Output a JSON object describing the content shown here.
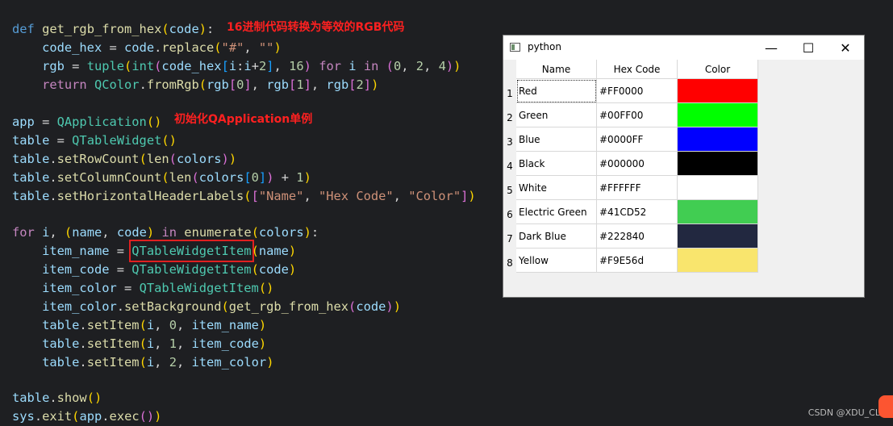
{
  "code_lines": [
    "def get_rgb_from_hex(code):",
    "    code_hex = code.replace(\"#\", \"\")",
    "    rgb = tuple(int(code_hex[i:i+2], 16) for i in (0, 2, 4))",
    "    return QColor.fromRgb(rgb[0], rgb[1], rgb[2])",
    "",
    "app = QApplication()",
    "table = QTableWidget()",
    "table.setRowCount(len(colors))",
    "table.setColumnCount(len(colors[0]) + 1)",
    "table.setHorizontalHeaderLabels([\"Name\", \"Hex Code\", \"Color\"])",
    "",
    "for i, (name, code) in enumerate(colors):",
    "    item_name = QTableWidgetItem(name)",
    "    item_code = QTableWidgetItem(code)",
    "    item_color = QTableWidgetItem()",
    "    item_color.setBackground(get_rgb_from_hex(code))",
    "    table.setItem(i, 0, item_name)",
    "    table.setItem(i, 1, item_code)",
    "    table.setItem(i, 2, item_color)",
    "",
    "table.show()",
    "sys.exit(app.exec())"
  ],
  "annotations": {
    "hex_to_rgb": "16进制代码转换为等效的RGB代码",
    "init_app": "初始化QApplication单例"
  },
  "window": {
    "title": "python",
    "icon": "app-window-icon",
    "controls": {
      "minimize": "—",
      "maximize": "☐",
      "close": "✕"
    }
  },
  "table": {
    "headers": [
      "Name",
      "Hex Code",
      "Color"
    ],
    "rows": [
      {
        "num": "1",
        "name": "Red",
        "hex": "#FF0000",
        "color": "#FF0000"
      },
      {
        "num": "2",
        "name": "Green",
        "hex": "#00FF00",
        "color": "#00FF00"
      },
      {
        "num": "3",
        "name": "Blue",
        "hex": "#0000FF",
        "color": "#0000FF"
      },
      {
        "num": "4",
        "name": "Black",
        "hex": "#000000",
        "color": "#000000"
      },
      {
        "num": "5",
        "name": "White",
        "hex": "#FFFFFF",
        "color": "#FFFFFF"
      },
      {
        "num": "6",
        "name": "Electric Green",
        "hex": "#41CD52",
        "color": "#41CD52"
      },
      {
        "num": "7",
        "name": "Dark Blue",
        "hex": "#222840",
        "color": "#222840"
      },
      {
        "num": "8",
        "name": "Yellow",
        "hex": "#F9E56d",
        "color": "#F9E56d"
      }
    ]
  },
  "watermark": "CSDN @XDU_CL"
}
